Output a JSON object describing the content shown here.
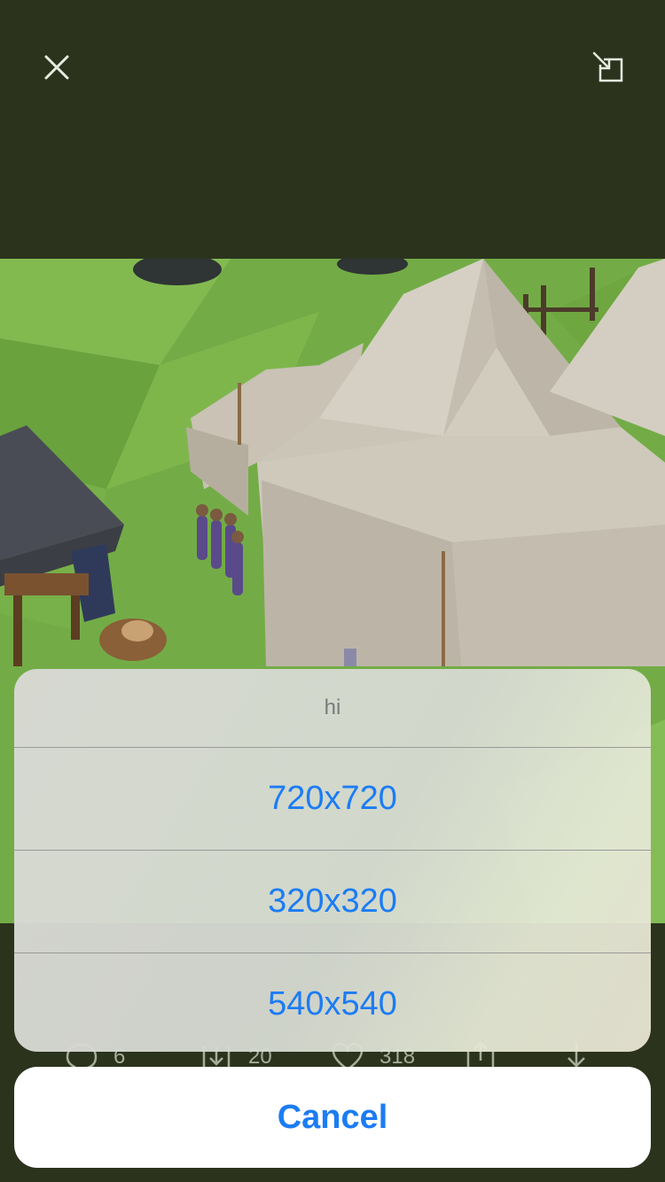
{
  "header": {
    "close_icon": "close-icon",
    "minimize_icon": "picture-in-picture-exit-icon"
  },
  "stats": {
    "comments": "6",
    "reposts": "20",
    "likes": "318"
  },
  "action_sheet": {
    "title": "hi",
    "options": [
      "720x720",
      "320x320",
      "540x540"
    ],
    "cancel_label": "Cancel"
  },
  "colors": {
    "background": "#2b331d",
    "accent": "#1c7cf4",
    "sheet_bg": "#d8dad4",
    "cancel_bg": "#ffffff"
  }
}
